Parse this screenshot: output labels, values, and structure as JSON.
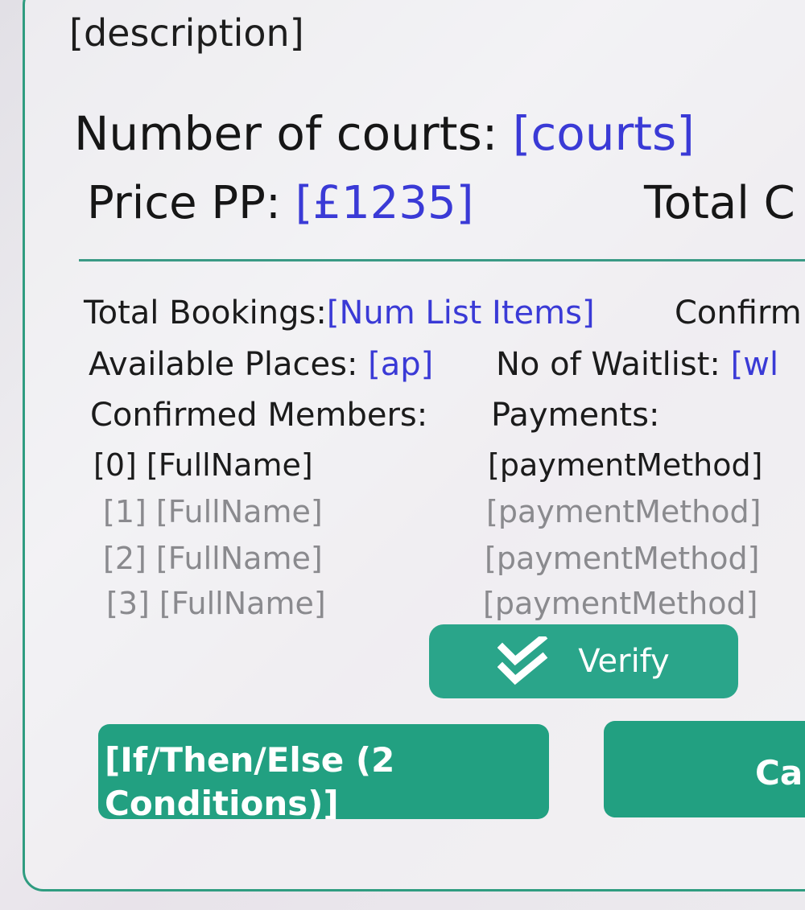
{
  "description": "[description]",
  "courts": {
    "label": "Number of courts:",
    "value": "[courts]"
  },
  "price": {
    "label": "Price PP:",
    "value": "[£1235]"
  },
  "total_cost_label": "Total C",
  "stats": {
    "total_bookings_label": "Total Bookings:",
    "total_bookings_value": "[Num List Items]",
    "confirm_label": "Confirm",
    "available_places_label": "Available Places:",
    "available_places_value": "[ap]",
    "waitlist_label": "No of Waitlist:",
    "waitlist_value": "[wl"
  },
  "members": {
    "heading": "Confirmed Members:",
    "payments_heading": "Payments:",
    "rows": [
      {
        "index": "[0]",
        "name": "[FullName]",
        "payment": "[paymentMethod]"
      },
      {
        "index": "[1]",
        "name": "[FullName]",
        "payment": "[paymentMethod]"
      },
      {
        "index": "[2]",
        "name": "[FullName]",
        "payment": "[paymentMethod]"
      },
      {
        "index": "[3]",
        "name": "[FullName]",
        "payment": "[paymentMethod]"
      }
    ]
  },
  "verify_button": {
    "label": "Verify",
    "icon": "double-check-icon"
  },
  "actions": {
    "condition_label": "[If/Then/Else (2 Conditions)]",
    "second_label": "Ca"
  },
  "colors": {
    "accent": "#2aa58a",
    "link_blue": "#3a3ad6",
    "faded_text": "#8a8a8e"
  }
}
